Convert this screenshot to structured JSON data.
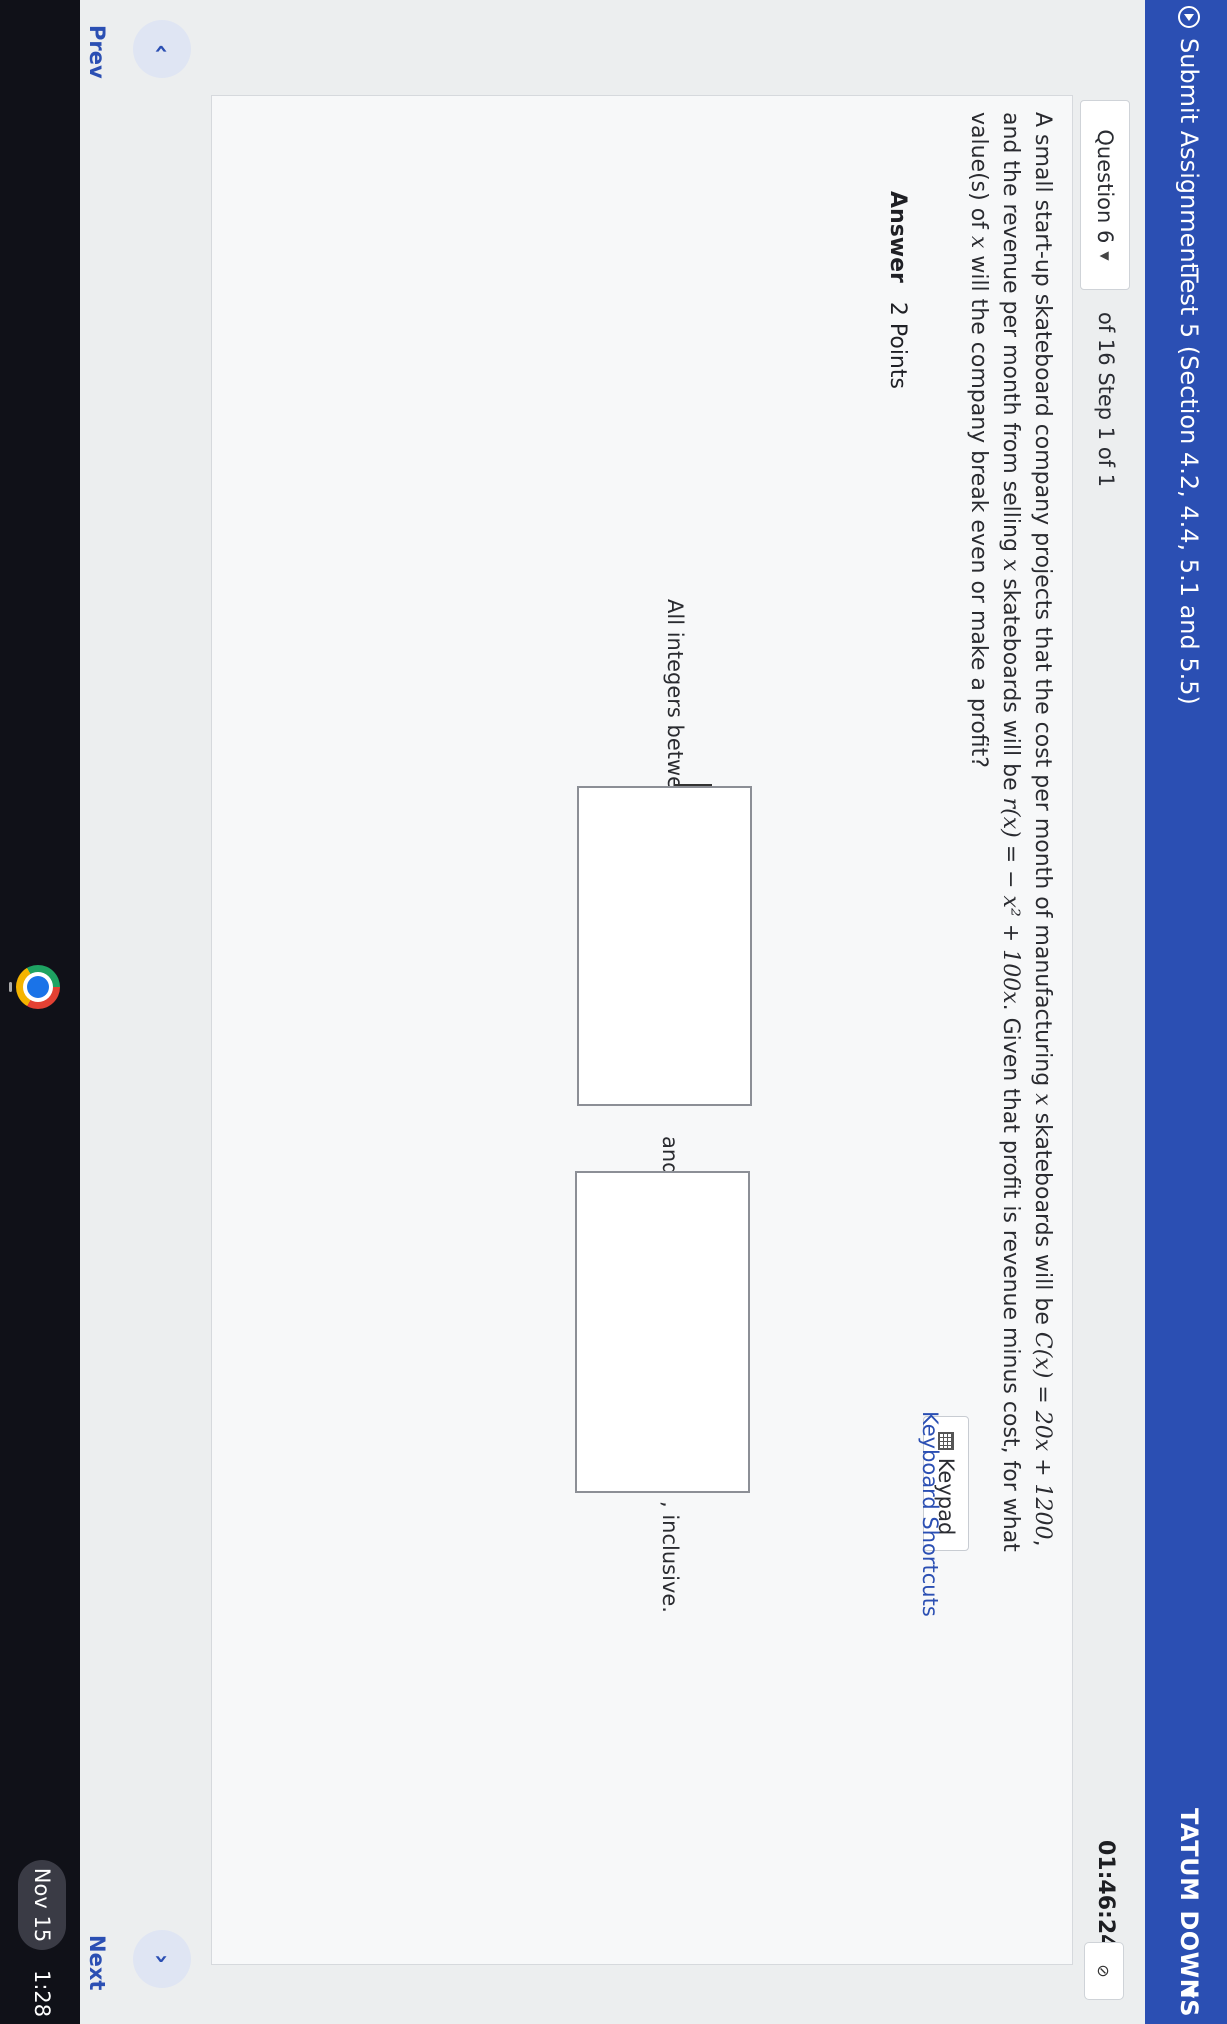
{
  "header": {
    "submit_label": "Submit Assignment",
    "test_title": "Test 5 (Section 4.2, 4.4, 5.1 and 5.5)",
    "user_name": "TATUM DOWNS"
  },
  "question_bar": {
    "question_label": "Question 6",
    "step_text": "of 16 Step 1 of 1",
    "timer": "01:46:24"
  },
  "problem": {
    "part1": "A small start-up skateboard company projects that the cost per month of manufacturing ",
    "var_x": "x",
    "part2": " skateboards will be ",
    "cost_fn": "C(x) = 20x + 1200",
    "part3": ", and the revenue per month from selling ",
    "part4": " skateboards will be ",
    "rev_fn": "r(x) = − x² + 100x",
    "part5": ". Given that profit is revenue minus cost, for what value(s) of ",
    "part6": " will the company break even or make a profit?"
  },
  "answer": {
    "label": "Answer",
    "points": "2 Points",
    "keypad_label": "Keypad",
    "shortcuts_label": "Keyboard Shortcuts",
    "prefix": "All integers between",
    "joiner": "and",
    "suffix": ", inclusive.",
    "input1_value": "",
    "input2_value": ""
  },
  "nav": {
    "prev_label": "Prev",
    "next_label": "Next"
  },
  "taskbar": {
    "date": "Nov 15",
    "time": "1:28"
  },
  "colors": {
    "brand_blue": "#2b4fb3",
    "page_bg": "#eceeef"
  }
}
